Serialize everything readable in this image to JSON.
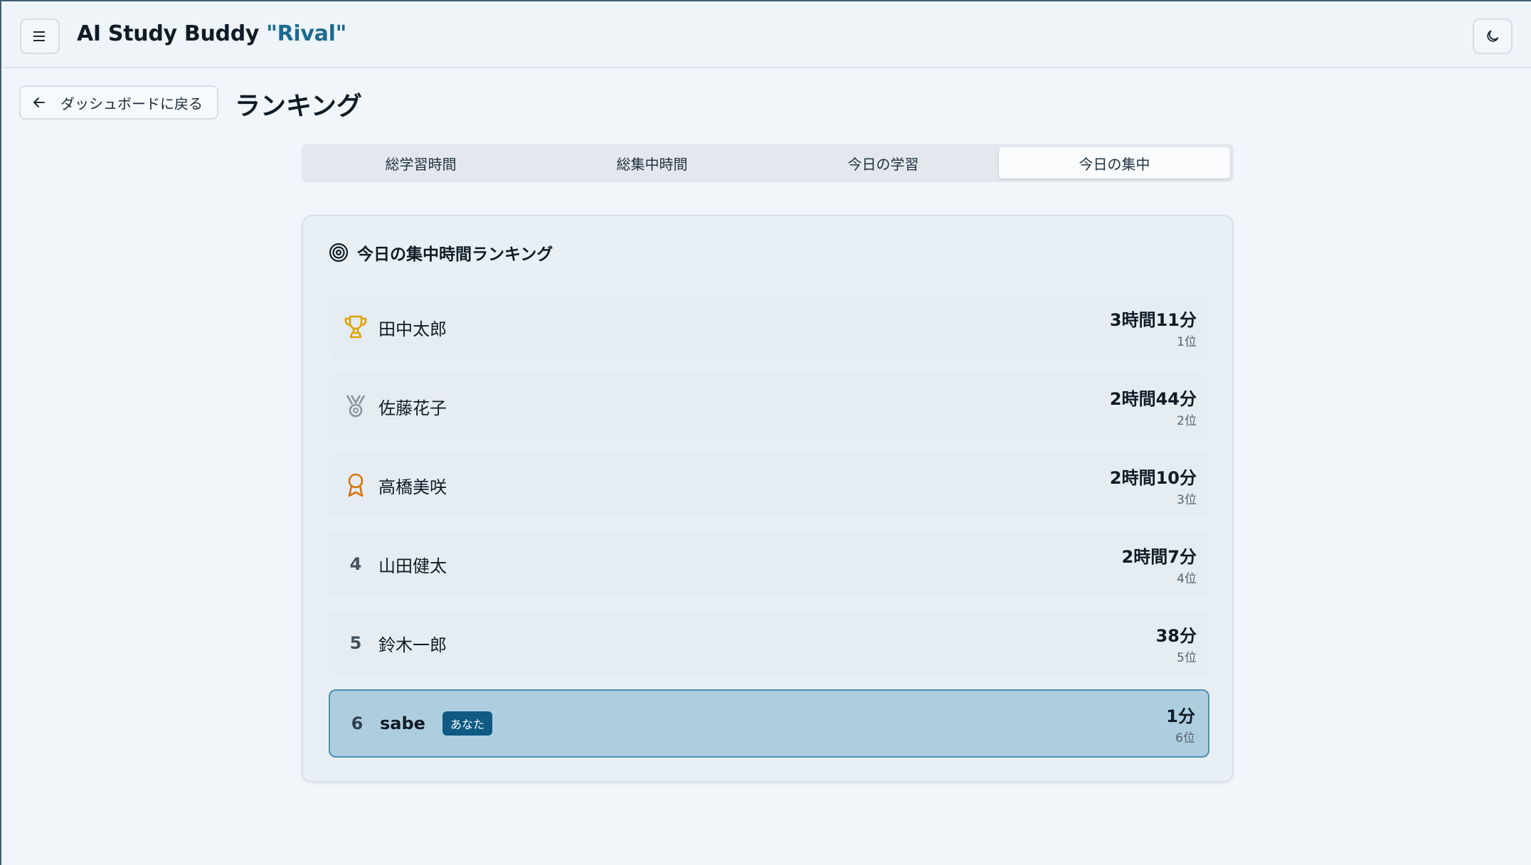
{
  "header": {
    "app_title": "AI Study Buddy",
    "app_title_accent": "\"Rival\"",
    "menu_icon": "hamburger-icon",
    "theme_icon": "moon-icon"
  },
  "nav": {
    "back_label": "ダッシュボードに戻る",
    "page_title": "ランキング"
  },
  "tabs": [
    {
      "label": "総学習時間",
      "active": false
    },
    {
      "label": "総集中時間",
      "active": false
    },
    {
      "label": "今日の学習",
      "active": false
    },
    {
      "label": "今日の集中",
      "active": true
    }
  ],
  "ranking": {
    "title": "今日の集中時間ランキング",
    "title_icon": "target-icon",
    "rows": [
      {
        "rank": "",
        "icon": "trophy-icon",
        "name": "田中太郎",
        "time": "3時間11分",
        "place": "1位"
      },
      {
        "rank": "",
        "icon": "medal-icon",
        "name": "佐藤花子",
        "time": "2時間44分",
        "place": "2位"
      },
      {
        "rank": "",
        "icon": "award-icon",
        "name": "高橋美咲",
        "time": "2時間10分",
        "place": "3位"
      },
      {
        "rank": "4",
        "icon": "",
        "name": "山田健太",
        "time": "2時間7分",
        "place": "4位"
      },
      {
        "rank": "5",
        "icon": "",
        "name": "鈴木一郎",
        "time": "38分",
        "place": "5位"
      },
      {
        "rank": "6",
        "icon": "",
        "name": "sabe",
        "badge": "あなた",
        "time": "1分",
        "place": "6位"
      }
    ]
  },
  "colors": {
    "accent": "#1c6a8f",
    "gold": "#e0a100",
    "silver": "#8b939b",
    "bronze": "#d8720b",
    "highlight_row": "#aecee0",
    "badge_bg": "#0e5a82"
  }
}
